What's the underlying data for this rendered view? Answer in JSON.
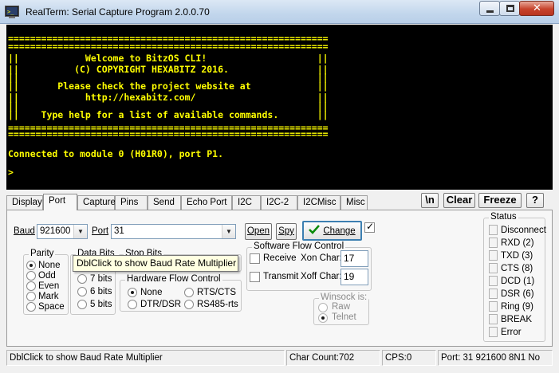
{
  "window": {
    "title": "RealTerm: Serial Capture Program 2.0.0.70"
  },
  "terminal": {
    "lines": [
      "==========================================================",
      "==========================================================",
      "||            Welcome to BitzOS CLI!                    ||",
      "||          (C) COPYRIGHT HEXABITZ 2016.                ||",
      "||                                                      ||",
      "||       Please check the project website at            ||",
      "||            http://hexabitz.com/                      ||",
      "||                                                      ||",
      "||    Type help for a list of available commands.       ||",
      "==========================================================",
      "==========================================================",
      "",
      "Connected to module 0 (H01R0), port P1.",
      "",
      ">"
    ],
    "text_color": "#ffff00",
    "background": "#000000"
  },
  "tabs": [
    "Display",
    "Port",
    "Capture",
    "Pins",
    "Send",
    "Echo Port",
    "I2C",
    "I2C-2",
    "I2CMisc",
    "Misc"
  ],
  "active_tab": "Port",
  "toolbar": {
    "newline_label": "\\n",
    "clear_label": "Clear",
    "freeze_label": "Freeze",
    "help_label": "?"
  },
  "port": {
    "baud_label": "Baud",
    "baud_value": "921600",
    "port_label": "Port",
    "port_value": "31",
    "open_label": "Open",
    "spy_label": "Spy",
    "change_label": "Change"
  },
  "parity": {
    "title": "Parity",
    "options": [
      "None",
      "Odd",
      "Even",
      "Mark",
      "Space"
    ],
    "selected": "None"
  },
  "data_bits": {
    "title": "Data Bits",
    "options": [
      "7 bits",
      "6 bits",
      "5 bits"
    ]
  },
  "stop_bits": {
    "title": "Stop Bits"
  },
  "hardware_flow": {
    "title": "Hardware Flow Control",
    "options": [
      "None",
      "RTS/CTS",
      "DTR/DSR",
      "RS485-rts"
    ],
    "selected": "None"
  },
  "software_flow": {
    "title": "Software Flow Control",
    "receive_label": "Receive",
    "xon_label": "Xon Char:",
    "xon_value": "17",
    "transmit_label": "Transmit",
    "xoff_label": "Xoff Char:",
    "xoff_value": "19"
  },
  "winsock": {
    "title": "Winsock is:",
    "options": [
      "Raw",
      "Telnet"
    ],
    "selected": "Telnet"
  },
  "status_panel": {
    "title": "Status",
    "items": [
      "Disconnect",
      "RXD (2)",
      "TXD (3)",
      "CTS (8)",
      "DCD (1)",
      "DSR (6)",
      "Ring (9)",
      "BREAK",
      "Error"
    ]
  },
  "tooltip": "DblClick to show Baud Rate Multiplier",
  "statusbar": {
    "hint": "DblClick to show Baud Rate Multiplier",
    "char_count": "Char Count:702",
    "cps": "CPS:0",
    "port_info": "Port: 31 921600 8N1 No"
  }
}
